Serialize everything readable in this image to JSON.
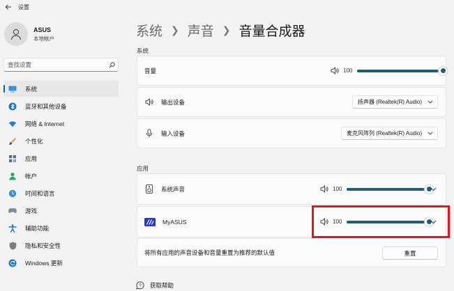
{
  "window": {
    "title": "设置"
  },
  "user": {
    "name": "ASUS",
    "account": "本地帐户"
  },
  "search": {
    "placeholder": "查找设置"
  },
  "nav": [
    {
      "label": "系统",
      "icon": "monitor-icon",
      "active": true
    },
    {
      "label": "蓝牙和其他设备",
      "icon": "bluetooth-icon"
    },
    {
      "label": "网络 & Internet",
      "icon": "wifi-icon"
    },
    {
      "label": "个性化",
      "icon": "brush-icon"
    },
    {
      "label": "应用",
      "icon": "apps-icon"
    },
    {
      "label": "帐户",
      "icon": "person-icon"
    },
    {
      "label": "时间和语言",
      "icon": "globe-clock-icon"
    },
    {
      "label": "游戏",
      "icon": "gamepad-icon"
    },
    {
      "label": "辅助功能",
      "icon": "accessibility-icon"
    },
    {
      "label": "隐私和安全性",
      "icon": "shield-icon"
    },
    {
      "label": "Windows 更新",
      "icon": "update-icon"
    }
  ],
  "breadcrumb": {
    "level1": "系统",
    "level2": "声音",
    "current": "音量合成器"
  },
  "system_section": {
    "label": "系统",
    "volume": {
      "label": "音量",
      "value": "100",
      "level": 1.0
    },
    "output": {
      "label": "输出设备",
      "selected": "扬声器 (Realtek(R) Audio)"
    },
    "input": {
      "label": "输入设备",
      "selected": "麦克风阵列 (Realtek(R) Audio)"
    }
  },
  "apps_section": {
    "label": "应用",
    "apps": [
      {
        "name": "系统声音",
        "value": "100",
        "level": 1.0,
        "icon": "speaker-device-icon"
      },
      {
        "name": "MyASUS",
        "value": "100",
        "level": 1.0,
        "icon": "myasus-logo-icon"
      }
    ]
  },
  "reset": {
    "text": "将所有应用的声音设备和音量重置为推荐的默认值",
    "button": "重置"
  },
  "help": {
    "label": "获取帮助"
  },
  "colors": {
    "accent": "#005fb8",
    "slider": "#1f5e74",
    "highlight": "#e6141c",
    "myasus": "#2a39c8"
  }
}
